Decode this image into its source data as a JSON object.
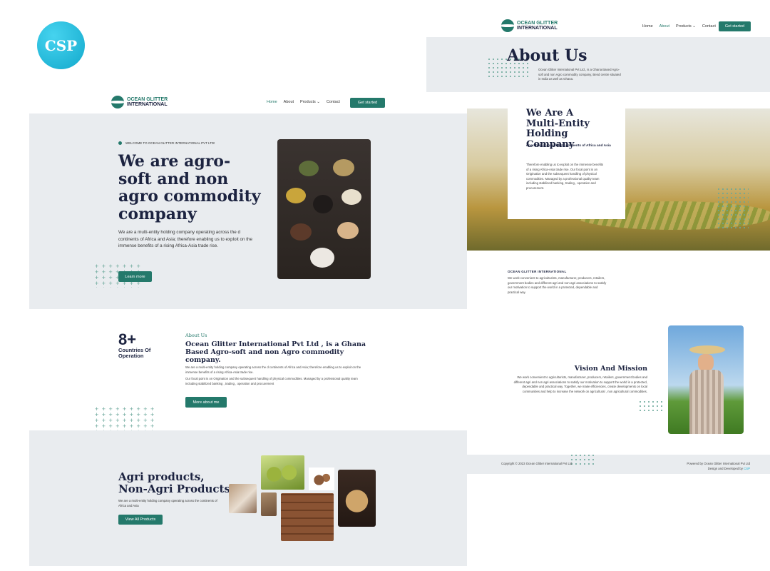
{
  "badge": {
    "text": "CSP"
  },
  "brand": {
    "line1": "OCEAN GLITTER",
    "line2": "INTERNATIONAL"
  },
  "nav": {
    "home": "Home",
    "about": "About",
    "products": "Products",
    "contact": "Contact",
    "cta": "Get started"
  },
  "hero": {
    "eyebrow": "WELCOME TO OCEAN GLITTER INTERNATIONAL PVT LTD!",
    "title": "We are agro-soft and non agro commodity company",
    "body": "We are a multi-entity holding company operating across the d continents of Africa and Asia; therefore enabling us to exploit on the immense benefits of a rising Africa-Asia trade rise.",
    "button": "Learn more"
  },
  "stats": {
    "number": "8+",
    "label": "Countries Of Operation"
  },
  "about_section": {
    "eyebrow": "About Us",
    "title": "Ocean Glitter International Pvt Ltd , is a Ghana Based Agro-soft and non Agro commodity company.",
    "body1": "We are a multi-entity holding company operating across the d continents of Africa and Asia; therefore enabling us to exploit on the immense benefits of a rising Africa-Asia trade rise.",
    "body2": "Our focal point is on Origination and the subsequent handling of physical commodities. Managed by a professional quality team including stabilized banking , trading , operation and procurement",
    "button": "More about me"
  },
  "products": {
    "title1": "Agri products,",
    "title2": "Non-Agri Products",
    "body": "We are a multi-entity holding company operating across the continents of Africa and Asia",
    "button": "View All Products"
  },
  "about_page": {
    "title": "About Us",
    "intro": "Ocean Glitter International Pvt Ltd., is a Ghana Based Agro-soft and non Agro commodity company, Bend centre situated in India as well as Ghana.",
    "card_title": "We Are A Multi-Entity Holding Company",
    "card_sub": "operating across the d continents of Africa and Asia",
    "card_body": "Therefore enabling us to exploit on the immense benefits of a rising Africa-Asia trade rise. Our focal point is on Origination and the subsequent handling of physical commodities. Managed by a professional quality team including stabilized banking, trading , operation and procurement.",
    "org_label": "OCEAN GLITTER INTERNATIONAL",
    "org_body": "We work convenient to agriculturists, manufacturer, producers, retailers, government bodies and different agri and non-agri associations to satisfy our motivation to support the world in a protected, dependable and practical way.",
    "vision_title": "Vision And Mission",
    "vision_body": "We work convenient to agriculturists, manufacturer, producers, retailers, government bodies and different agri and non agri associations to satisfy our motivation to support the world in a protected, dependable and practical way. Together, we make efficiencies, create developments on local communities and help to increase the network on agricultural , non agricultural commodities.",
    "copyright": "Copyright © 2023 Ocean Glitter International Pvt Ltd",
    "powered": "Powered by Ocean Glitter International Pvt Ltd",
    "designed_prefix": "Design and Developed by",
    "designed_link": "CSP"
  },
  "colors": {
    "accent": "#24796b",
    "navy": "#1c2340",
    "badge": "#19b4d6",
    "panel": "#e9ecef"
  }
}
